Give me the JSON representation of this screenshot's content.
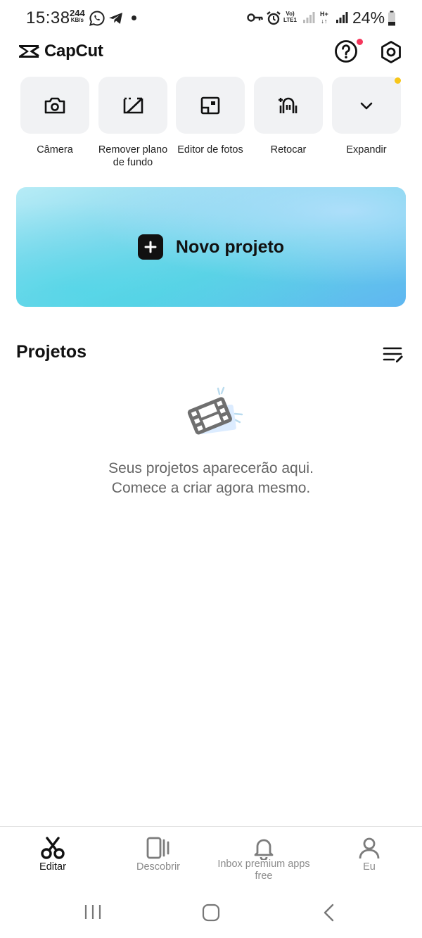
{
  "status_bar": {
    "time": "15:38",
    "speed_value": "244",
    "speed_unit": "KB/s",
    "volte_top": "Vo)",
    "volte_bottom": "LTE1",
    "hplus_top": "H+",
    "battery": "24%"
  },
  "header": {
    "app_name": "CapCut"
  },
  "tools": [
    {
      "label": "Câmera",
      "icon": "camera-icon"
    },
    {
      "label": "Remover plano de fundo",
      "icon": "remove-background-icon"
    },
    {
      "label": "Editor de fotos",
      "icon": "photo-editor-icon"
    },
    {
      "label": "Retocar",
      "icon": "retouch-icon"
    },
    {
      "label": "Expandir",
      "icon": "chevron-down-icon"
    }
  ],
  "new_project": {
    "label": "Novo projeto"
  },
  "projects": {
    "title": "Projetos",
    "empty_line1": "Seus projetos aparecerão aqui.",
    "empty_line2": "Comece a criar agora mesmo."
  },
  "bottom_nav": [
    {
      "label": "Editar",
      "icon": "scissors-icon",
      "active": true
    },
    {
      "label": "Descobrir",
      "icon": "discover-icon",
      "active": false
    },
    {
      "label": "Inbox premium apps free",
      "icon": "bell-icon",
      "active": false
    },
    {
      "label": "Eu",
      "icon": "profile-icon",
      "active": false
    }
  ],
  "colors": {
    "notification_dot": "#f5365c",
    "expand_dot": "#f7c61a",
    "banner_gradient_start": "#b7ecf6",
    "banner_gradient_end": "#5fb6f1"
  }
}
